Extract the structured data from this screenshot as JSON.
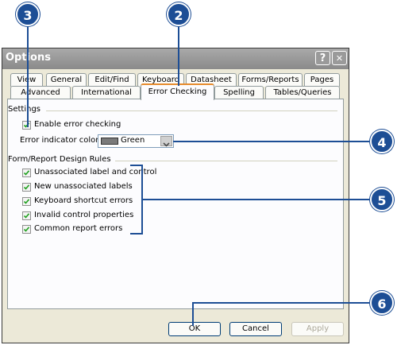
{
  "window": {
    "title": "Options",
    "help_glyph": "?",
    "close_glyph": "✕"
  },
  "tabs": {
    "row1": [
      "View",
      "General",
      "Edit/Find",
      "Keyboard",
      "Datasheet",
      "Forms/Reports",
      "Pages"
    ],
    "row2": [
      "Advanced",
      "International",
      "Error Checking",
      "Spelling",
      "Tables/Queries"
    ],
    "active": "Error Checking"
  },
  "settings": {
    "group_label": "Settings",
    "enable_label": "Enable error checking",
    "enable_checked": true,
    "color_label": "Error indicator color:",
    "color_value": "Green",
    "color_swatch": "#7a7a7a"
  },
  "rules": {
    "group_label": "Form/Report Design Rules",
    "items": [
      {
        "label": "Unassociated label and control",
        "checked": true
      },
      {
        "label": "New unassociated labels",
        "checked": true
      },
      {
        "label": "Keyboard shortcut errors",
        "checked": true
      },
      {
        "label": "Invalid control properties",
        "checked": true
      },
      {
        "label": "Common report errors",
        "checked": true
      }
    ]
  },
  "buttons": {
    "ok": "OK",
    "cancel": "Cancel",
    "apply": "Apply"
  },
  "callouts": {
    "c3": "3",
    "c2": "2",
    "c4": "4",
    "c5": "5",
    "c6": "6",
    "color": "#1d4e95"
  }
}
